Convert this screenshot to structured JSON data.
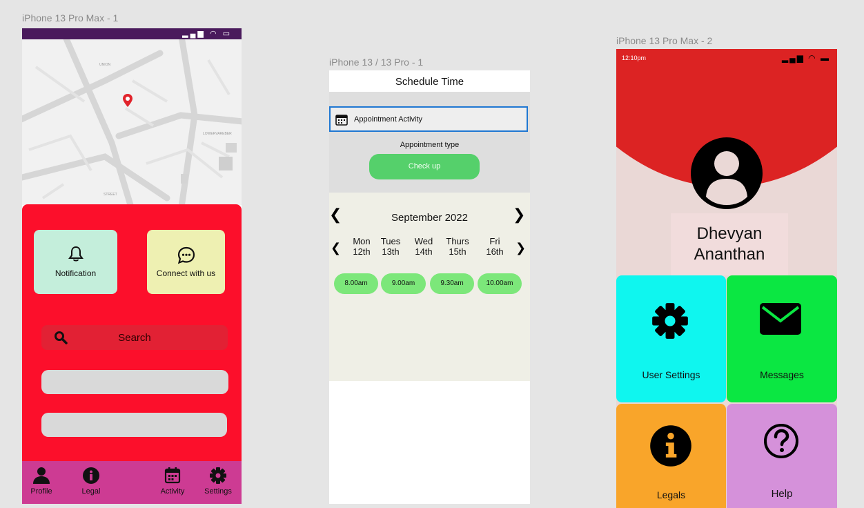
{
  "frames": {
    "frame1_label": "iPhone 13 Pro Max - 1",
    "frame2_label": "iPhone 13 / 13 Pro - 1",
    "frame3_label": "iPhone 13 Pro Max - 2"
  },
  "home": {
    "map_labels": [
      "UNION",
      "LOWERVAREBER",
      "STREET"
    ],
    "tiles": {
      "notification": "Notification",
      "connect": "Connect with us"
    },
    "search": {
      "label": "Search"
    },
    "nav": {
      "profile": "Profile",
      "legal": "Legal",
      "activity": "Activity",
      "settings": "Settings"
    },
    "colors": {
      "panel": "#fc0f2b",
      "nav": "#cd3b93",
      "notif_tile": "#c4eedb",
      "connect_tile": "#eef0b2"
    }
  },
  "schedule": {
    "title": "Schedule Time",
    "activity_field": "Appointment Activity",
    "appointment_type_label": "Appointment type",
    "appointment_type_value": "Check up",
    "month": "September 2022",
    "days": [
      {
        "name": "Mon",
        "date": "12th"
      },
      {
        "name": "Tues",
        "date": "13th"
      },
      {
        "name": "Wed",
        "date": "14th"
      },
      {
        "name": "Thurs",
        "date": "15th"
      },
      {
        "name": "Fri",
        "date": "16th"
      }
    ],
    "slots": [
      "8.00am",
      "9.00am",
      "9.30am",
      "10.00am"
    ]
  },
  "profile": {
    "time": "12:10pm",
    "first_name": "Dhevyan",
    "last_name": "Ananthan",
    "tiles": {
      "user_settings": "User Settings",
      "messages": "Messages",
      "legals": "Legals",
      "help": "Help"
    },
    "colors": {
      "header": "#dc2323",
      "settings": "#0ff6ef",
      "messages": "#0be742",
      "legals": "#f9a52a",
      "help": "#d591da"
    }
  }
}
